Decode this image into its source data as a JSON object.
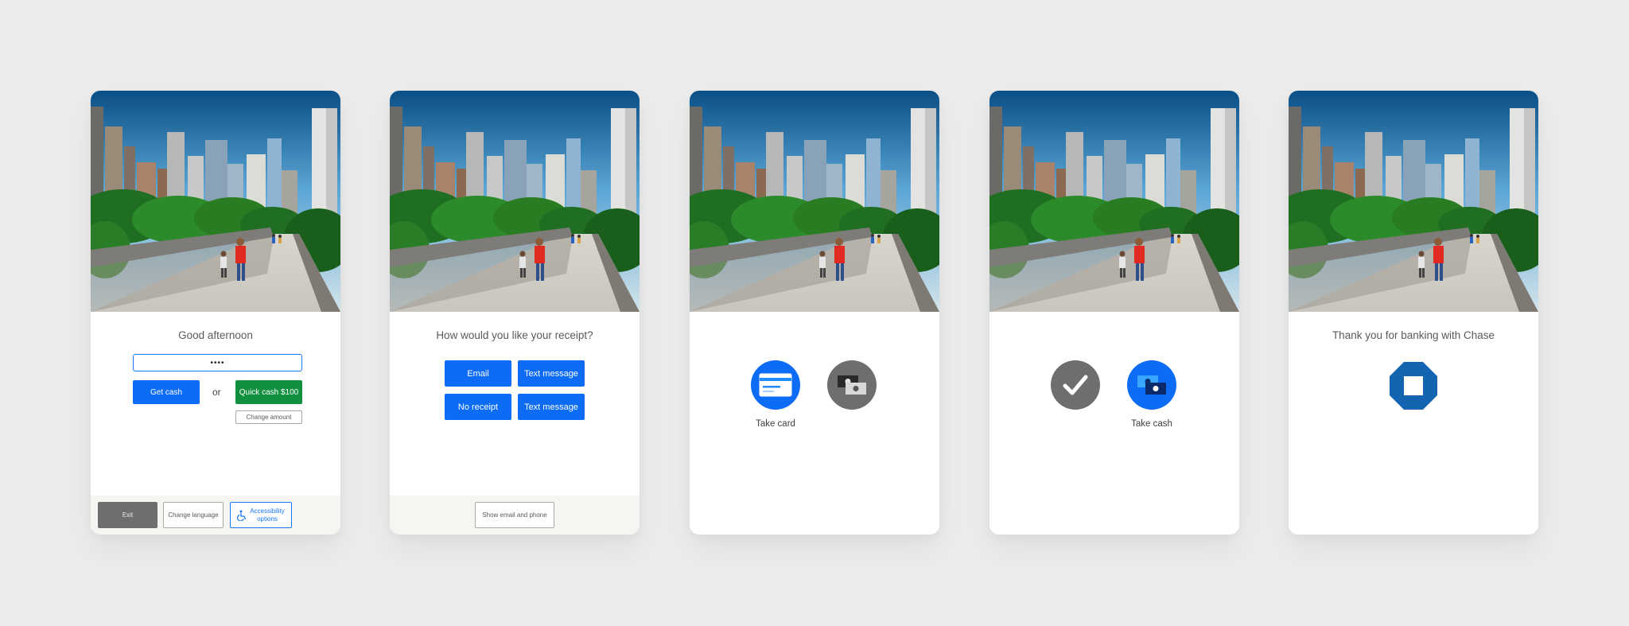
{
  "screens": [
    {
      "title": "Good afternoon",
      "pin_value": "••••",
      "get_cash_label": "Get cash",
      "or_label": "or",
      "quick_cash_label": "Quick cash $100",
      "change_amount_label": "Change amount",
      "footer": {
        "exit_label": "Exit",
        "change_language_label": "Change language",
        "accessibility_label": "Accessibility options"
      }
    },
    {
      "title": "How would you like your receipt?",
      "options": [
        "Email",
        "Text message",
        "No receipt",
        "Text message"
      ],
      "footer": {
        "show_email_label": "Show email and phone"
      }
    },
    {
      "take_card_label": "Take card",
      "icons": [
        "card-icon",
        "cash-icon"
      ]
    },
    {
      "take_cash_label": "Take cash",
      "icons": [
        "checkmark-icon",
        "cash-icon"
      ]
    },
    {
      "title": "Thank you for banking with Chase",
      "icons": [
        "chase-logo-icon"
      ]
    }
  ],
  "colors": {
    "page_background": "#ececec",
    "primary_blue": "#0c6cf6",
    "success_green": "#11903f",
    "inactive_gray": "#6e6e6e",
    "chase_blue": "#1465b1",
    "footer_background": "#f6f5f2"
  }
}
